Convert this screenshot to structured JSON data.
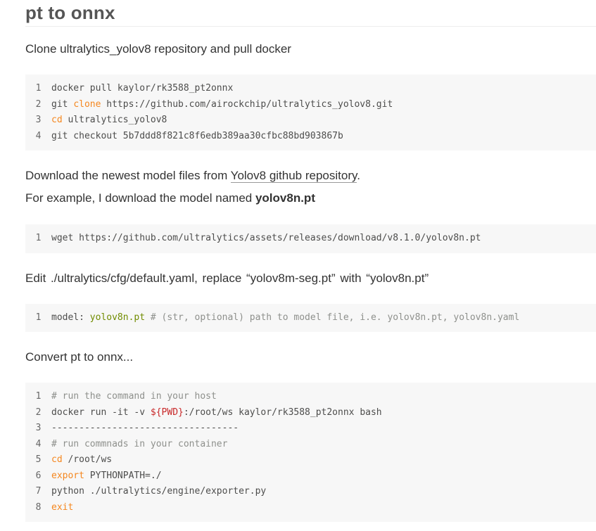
{
  "heading": "pt to onnx",
  "para1": "Clone ultralytics_yolov8 repository and pull docker",
  "code1": [
    {
      "n": "1",
      "parts": [
        {
          "t": "docker pull kaylor/rk3588_pt2onnx",
          "c": ""
        }
      ]
    },
    {
      "n": "2",
      "parts": [
        {
          "t": "git ",
          "c": ""
        },
        {
          "t": "clone",
          "c": "kw"
        },
        {
          "t": " https://github.com/airockchip/ultralytics_yolov8.git",
          "c": ""
        }
      ]
    },
    {
      "n": "3",
      "parts": [
        {
          "t": "cd",
          "c": "kw"
        },
        {
          "t": " ultralytics_yolov8",
          "c": ""
        }
      ]
    },
    {
      "n": "4",
      "parts": [
        {
          "t": "git checkout 5b7ddd8f821c8f6edb389aa30cfbc88bd903867b",
          "c": ""
        }
      ]
    }
  ],
  "para2": {
    "prefix": "Download the newest model files from ",
    "link": "Yolov8 github repository",
    "suffix": "."
  },
  "para3": {
    "prefix": "For example, I download the model named ",
    "bold": "yolov8n.pt"
  },
  "code2": [
    {
      "n": "1",
      "parts": [
        {
          "t": "wget https://github.com/ultralytics/assets/releases/download/v8.1.0/yolov8n.pt",
          "c": ""
        }
      ]
    }
  ],
  "para4": "Edit ./ultralytics/cfg/default.yaml, replace “yolov8m-seg.pt” with “yolov8n.pt”",
  "code3": [
    {
      "n": "1",
      "parts": [
        {
          "t": "model: ",
          "c": ""
        },
        {
          "t": "yolov8n.pt",
          "c": "str"
        },
        {
          "t": " # (str, optional) path to model file, i.e. yolov8n.pt, yolov8n.yaml",
          "c": "cm"
        }
      ]
    }
  ],
  "para5": "Convert pt to onnx...",
  "code4": [
    {
      "n": "1",
      "parts": [
        {
          "t": "# run the command in your host",
          "c": "cm"
        }
      ]
    },
    {
      "n": "2",
      "parts": [
        {
          "t": "docker run -it -v ",
          "c": ""
        },
        {
          "t": "${PWD}",
          "c": "var"
        },
        {
          "t": ":/root/ws kaylor/rk3588_pt2onnx bash",
          "c": ""
        }
      ]
    },
    {
      "n": "3",
      "parts": [
        {
          "t": "----------------------------------",
          "c": ""
        }
      ]
    },
    {
      "n": "4",
      "parts": [
        {
          "t": "# run commnads in your container",
          "c": "cm"
        }
      ]
    },
    {
      "n": "5",
      "parts": [
        {
          "t": "cd",
          "c": "kw"
        },
        {
          "t": " /root/ws",
          "c": ""
        }
      ]
    },
    {
      "n": "6",
      "parts": [
        {
          "t": "export",
          "c": "kw"
        },
        {
          "t": " PYTHONPATH=./",
          "c": ""
        }
      ]
    },
    {
      "n": "7",
      "parts": [
        {
          "t": "python ./ultralytics/engine/exporter.py",
          "c": ""
        }
      ]
    },
    {
      "n": "8",
      "parts": [
        {
          "t": "exit",
          "c": "kw"
        }
      ]
    }
  ]
}
